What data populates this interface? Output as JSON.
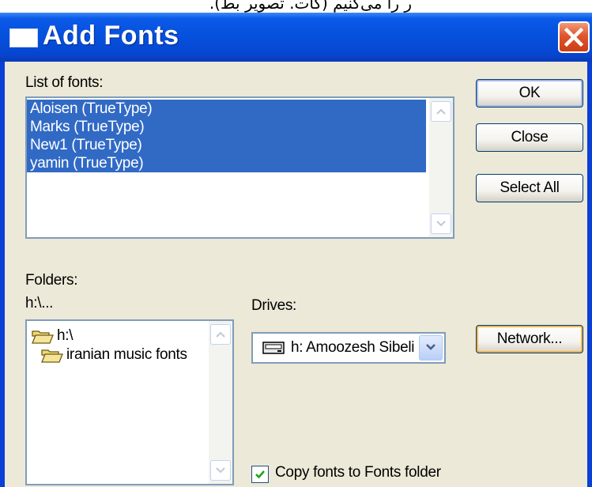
{
  "page_top_text": "ر را می‌کنیم (کات. تصویر بط).",
  "window": {
    "title": "Add Fonts",
    "icons": {
      "title": "window-icon",
      "close": "close-x-icon"
    }
  },
  "fonts_list": {
    "label": "List of fonts:",
    "items": [
      "Aloisen (TrueType)",
      "Marks (TrueType)",
      "New1 (TrueType)",
      "yamin (TrueType)"
    ],
    "selected_all": true
  },
  "buttons": {
    "ok": "OK",
    "close": "Close",
    "select_all": "Select All",
    "network": "Network..."
  },
  "folders": {
    "label": "Folders:",
    "current_path": "h:\\...",
    "items": [
      "h:\\",
      "iranian music fonts"
    ],
    "icons": [
      "open-folder-icon",
      "open-folder-icon"
    ]
  },
  "drives": {
    "label": "Drives:",
    "selected": "h: Amoozesh Sibeli",
    "icon": "drive-icon"
  },
  "copy_option": {
    "label": "Copy fonts to Fonts folder",
    "checked": true
  },
  "colors": {
    "titlebar": "#0550dc",
    "window_bg": "#ece9d8",
    "selection": "#316ac5",
    "close_button": "#e0562e"
  }
}
